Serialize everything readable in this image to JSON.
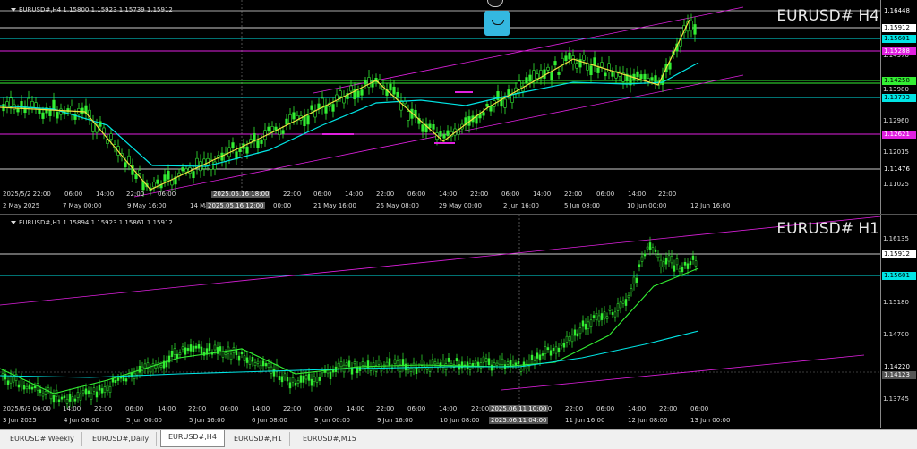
{
  "chart_top": {
    "header": "EURUSD#,H4  1.15800 1.15923 1.15739 1.15912",
    "symbol": "EURUSD# H4",
    "price_ticks": [
      "1.14970",
      "1.13980",
      "1.12960",
      "1.12015",
      "1.11025"
    ],
    "price_tags": [
      {
        "text": "1.16448",
        "color": "#ffffff",
        "bg": "#000000"
      },
      {
        "text": "1.15912",
        "color": "#000000",
        "bg": "#ffffff"
      },
      {
        "text": "1.15601",
        "color": "#000000",
        "bg": "#00e5e5"
      },
      {
        "text": "1.15288",
        "color": "#ffffff",
        "bg": "#e020e0"
      },
      {
        "text": "1.14258",
        "color": "#000000",
        "bg": "#33ee33"
      },
      {
        "text": "1.13733",
        "color": "#000000",
        "bg": "#00e5e5"
      },
      {
        "text": "1.12621",
        "color": "#ffffff",
        "bg": "#e020e0"
      },
      {
        "text": "1.11476",
        "color": "#ffffff",
        "bg": "#000000"
      }
    ],
    "time_labels": [
      "2025/5/2 22:00",
      "06:00",
      "14:00",
      "22:00",
      "06:00",
      "14:00",
      "22:00",
      "06:00",
      "14:00",
      "22:00",
      "06:00",
      "14:00",
      "22:00",
      "06:00",
      "14:00",
      "22:00",
      "06:00",
      "14:00",
      "22:00"
    ],
    "date_labels": [
      "2 May 2025",
      "7 May 00:00",
      "9 May 16:00",
      "14 May",
      "00:00",
      "21 May 16:00",
      "26 May 08:00",
      "29 May 00:00",
      "2 Jun 16:00",
      "5 Jun 08:00",
      "10 Jun 00:00",
      "12 Jun 16:00"
    ],
    "cursor_time": "2025.05.16 18:00",
    "cursor_date": "2025.05.16 12:00"
  },
  "chart_bottom": {
    "header": "EURUSD#,H1  1.15894 1.15923 1.15861 1.15912",
    "symbol": "EURUSD# H1",
    "price_ticks": [
      "1.16135",
      "1.15180",
      "1.14700",
      "1.13745"
    ],
    "price_tags": [
      {
        "text": "1.15912",
        "color": "#000000",
        "bg": "#ffffff"
      },
      {
        "text": "1.15601",
        "color": "#000000",
        "bg": "#00e5e5"
      },
      {
        "text": "1.14220",
        "color": "#ffffff",
        "bg": "#000000"
      },
      {
        "text": "1.14123",
        "color": "#ffffff",
        "bg": "#555555"
      }
    ],
    "time_labels": [
      "2025/6/3 06:00",
      "14:00",
      "22:00",
      "06:00",
      "14:00",
      "22:00",
      "06:00",
      "14:00",
      "22:00",
      "06:00",
      "14:00",
      "22:00",
      "06:00",
      "14:00",
      "22:00",
      "06:00",
      "14:00",
      "22:00",
      "06:00",
      "14:00",
      "22:00",
      "06:00"
    ],
    "date_labels": [
      "3 Jun 2025",
      "4 Jun 08:00",
      "5 Jun 00:00",
      "5 Jun 16:00",
      "6 Jun 08:00",
      "9 Jun 00:00",
      "9 Jun 16:00",
      "10 Jun 08:00",
      "11 Jun 16:00",
      "12 Jun 08:00",
      "13 Jun 00:00"
    ],
    "cursor_time": "2025.06.11 10:00",
    "cursor_date": "2025.06.11 04:00"
  },
  "tabs": [
    {
      "label": "EURUSD#,Weekly",
      "active": false
    },
    {
      "label": "EURUSD#,Daily",
      "active": false
    },
    {
      "label": "EURUSD#,H4",
      "active": true
    },
    {
      "label": "EURUSD#,H1",
      "active": false
    },
    {
      "label": "EURUSD#,M15",
      "active": false
    }
  ],
  "colors": {
    "bull": "#33ee33",
    "bear": "#33ee33",
    "ma_fast": "#33ee33",
    "ma_slow": "#00e5e5",
    "zigzag": "#f0e040",
    "channel": "#e020e0",
    "hline_green": "#33ee33",
    "hline_magenta": "#e020e0",
    "hline_cyan": "#00e5e5",
    "hline_white": "#ffffff"
  }
}
